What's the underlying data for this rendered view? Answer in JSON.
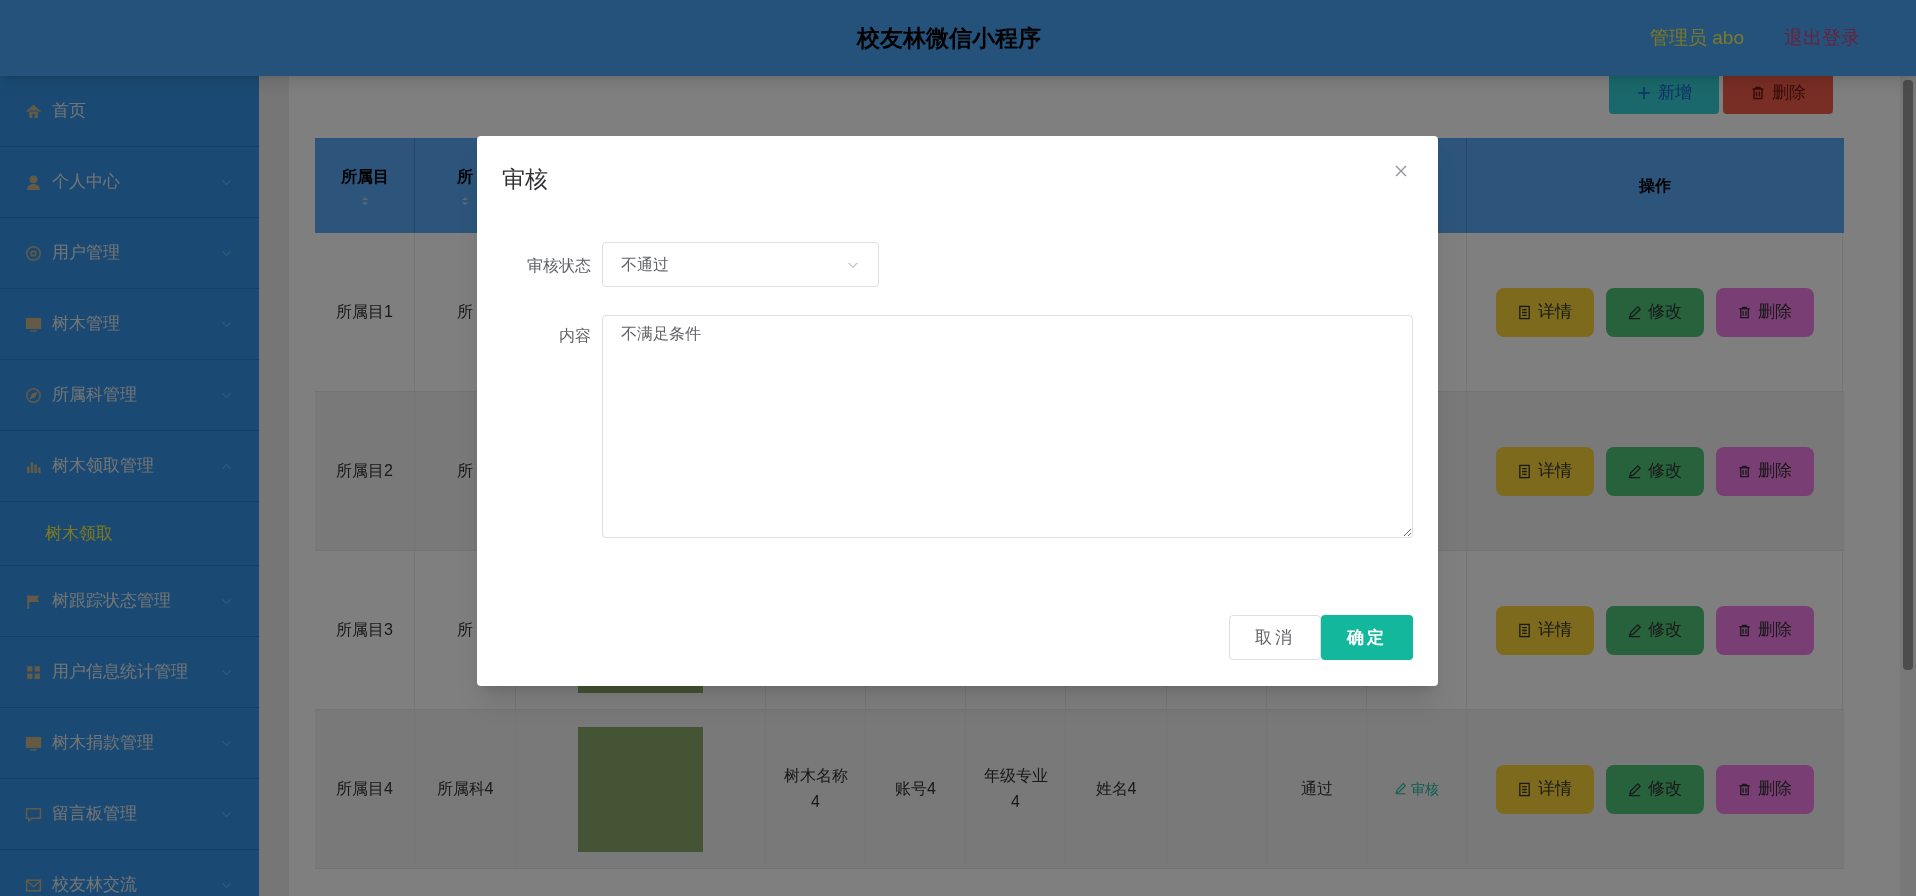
{
  "header": {
    "title": "校友林微信小程序",
    "user": "管理员 abo",
    "logout": "退出登录"
  },
  "sidebar": {
    "items": [
      {
        "label": "首页",
        "kind": "link"
      },
      {
        "label": "个人中心",
        "kind": "menu",
        "expanded": false
      },
      {
        "label": "用户管理",
        "kind": "menu",
        "expanded": false
      },
      {
        "label": "树木管理",
        "kind": "menu",
        "expanded": false
      },
      {
        "label": "所属科管理",
        "kind": "menu",
        "expanded": false
      },
      {
        "label": "树木领取管理",
        "kind": "menu",
        "expanded": true,
        "children": [
          {
            "label": "树木领取",
            "selected": true
          }
        ]
      },
      {
        "label": "树跟踪状态管理",
        "kind": "menu",
        "expanded": false
      },
      {
        "label": "用户信息统计管理",
        "kind": "menu",
        "expanded": false
      },
      {
        "label": "树木捐款管理",
        "kind": "menu",
        "expanded": false
      },
      {
        "label": "留言板管理",
        "kind": "menu",
        "expanded": false
      },
      {
        "label": "校友林交流",
        "kind": "menu",
        "expanded": false
      }
    ]
  },
  "toolbar": [
    {
      "label": "新增",
      "kind": "add"
    },
    {
      "label": "删除",
      "kind": "delete"
    }
  ],
  "table": {
    "header_cells": [
      {
        "label": "所属目",
        "sortable": true
      },
      {
        "label": "所",
        "sortable": true
      }
    ],
    "actions_heading": "操作",
    "rows": [
      {
        "category": "所属目1",
        "family": "所",
        "photo": false,
        "actions": [
          {
            "label": "详情",
            "kind": "detail"
          },
          {
            "label": "修改",
            "kind": "edit"
          },
          {
            "label": "删除",
            "kind": "delete"
          }
        ]
      },
      {
        "category": "所属目2",
        "family": "所",
        "photo": false,
        "actions": [
          {
            "label": "详情",
            "kind": "detail"
          },
          {
            "label": "修改",
            "kind": "edit"
          },
          {
            "label": "删除",
            "kind": "delete"
          }
        ]
      },
      {
        "category": "所属目3",
        "family": "所",
        "photo": true,
        "actions": [
          {
            "label": "详情",
            "kind": "detail"
          },
          {
            "label": "修改",
            "kind": "edit"
          },
          {
            "label": "删除",
            "kind": "delete"
          }
        ]
      },
      {
        "category": "所属目4",
        "family": "所属科4",
        "photo": true,
        "tree_name": "树木名称4",
        "account": "账号4",
        "major": "年级专业4",
        "name": "姓名4",
        "status": "通过",
        "review_link": "审核",
        "actions": [
          {
            "label": "详情",
            "kind": "detail"
          },
          {
            "label": "修改",
            "kind": "edit"
          },
          {
            "label": "删除",
            "kind": "delete"
          }
        ]
      }
    ]
  },
  "dialog": {
    "title": "审核",
    "fields": [
      {
        "label": "审核状态",
        "kind": "select",
        "value": "不通过"
      },
      {
        "label": "内容",
        "kind": "textarea",
        "value": "不满足条件"
      }
    ],
    "buttons": [
      {
        "label": "取消",
        "kind": "cancel"
      },
      {
        "label": "确定",
        "kind": "confirm"
      }
    ]
  }
}
